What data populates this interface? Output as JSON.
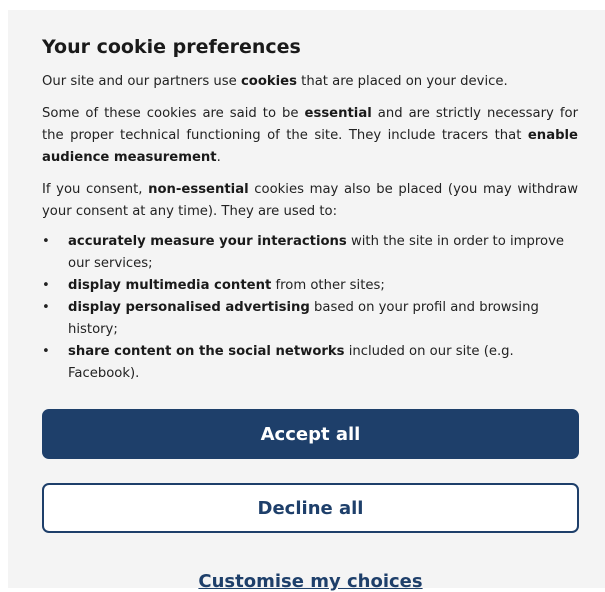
{
  "dialog": {
    "title": "Your cookie preferences",
    "intro": {
      "before": "Our site and our partners use ",
      "bold": "cookies",
      "after": " that are placed on your device."
    },
    "essential": {
      "t1": "Some of these cookies are said to be ",
      "b1": "essential",
      "t2": " and are strictly necessary for the proper technical functioning of the site. They include tracers that ",
      "b2": "enable audience measurement",
      "t3": "."
    },
    "consent": {
      "t1": "If you consent, ",
      "b1": "non-essential",
      "t2": " cookies may also be placed (you may withdraw your consent at any time). They are used to:"
    },
    "bullet_symbol": "•",
    "bullets": [
      {
        "bold": "accurately measure your interactions",
        "text": " with the site in order to improve our services;"
      },
      {
        "bold": "display multimedia content",
        "text": " from other sites;"
      },
      {
        "bold": "display personalised advertising",
        "text": " based on your profil and browsing history;"
      },
      {
        "bold": "share content on the social networks",
        "text": " included on our site (e.g. Facebook)."
      }
    ],
    "accept_label": "Accept all",
    "decline_label": "Decline all",
    "customise_label": "Customise my choices"
  },
  "colors": {
    "primary": "#1e3f6a",
    "panel_background": "#f4f4f4",
    "text": "#222222"
  }
}
